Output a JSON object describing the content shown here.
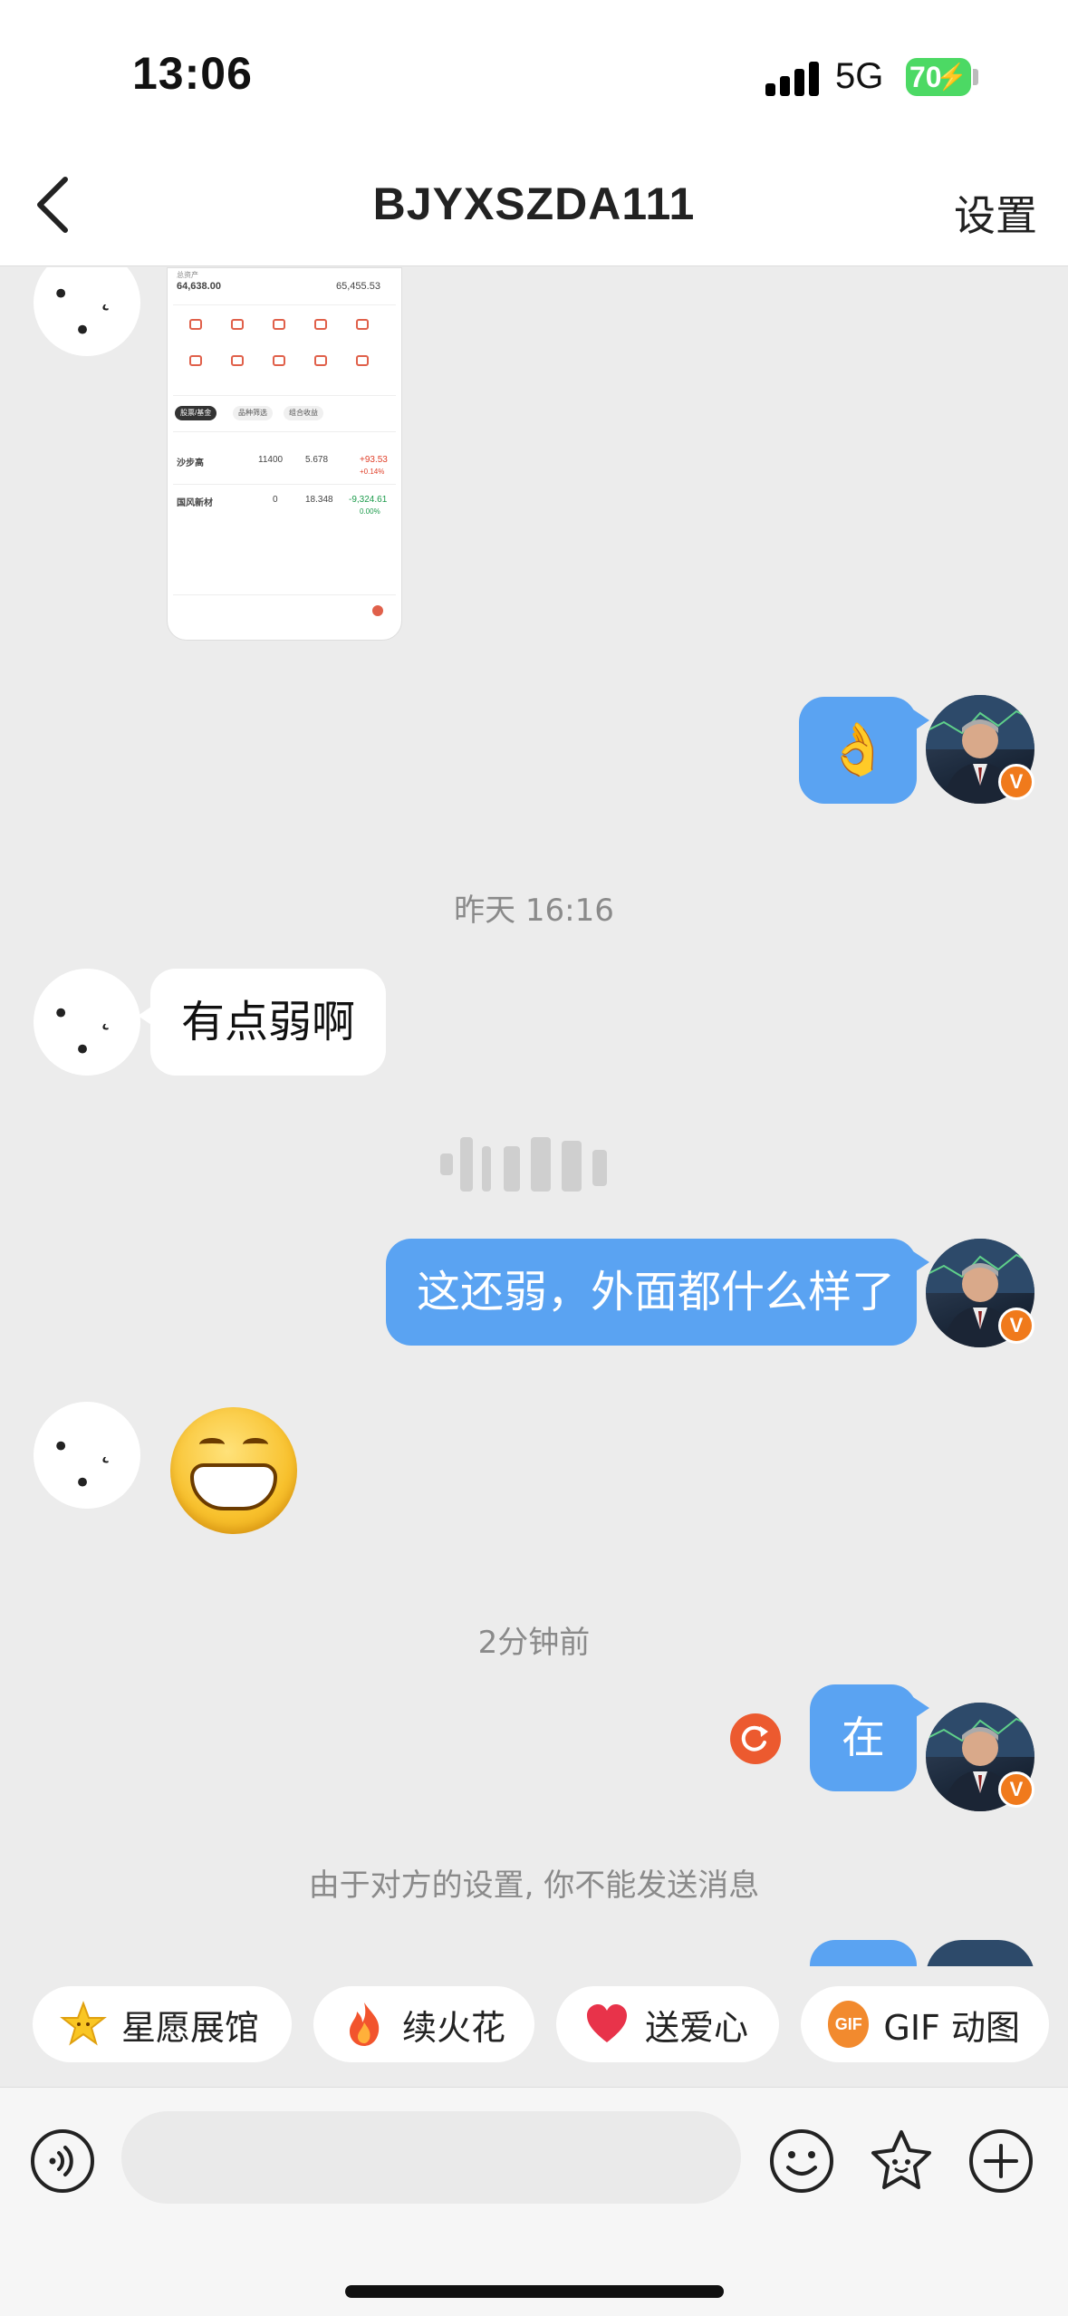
{
  "status_bar": {
    "time": "13:06",
    "network": "5G",
    "battery": "70"
  },
  "nav": {
    "title": "BJYXSZDA111",
    "settings_label": "设置"
  },
  "thumbnail": {
    "total_left": "64,638.00",
    "total_right": "65,455.53",
    "tab_1": "股票/基金",
    "tab_2": "品种筛选",
    "tab_3": "组合收益",
    "row_1_name": "沙步高",
    "row_1_qty": "11400",
    "row_1_price": "5.678",
    "row_1_pl": "+93.53",
    "row_1_pct": "+0.14%",
    "row_2_name": "国风新材",
    "row_2_qty": "0",
    "row_2_price": "18.348",
    "row_2_pl": "-9,324.61",
    "row_2_pct": "0.00%"
  },
  "messages": [
    {
      "side": "out",
      "text": "👌"
    },
    {
      "timestamp": "昨天 16:16"
    },
    {
      "side": "in",
      "text": "有点弱啊"
    },
    {
      "side": "out",
      "text": "这还弱，外面都什么样了"
    },
    {
      "side": "in",
      "text": "😁"
    },
    {
      "timestamp": "2分钟前"
    },
    {
      "side": "out",
      "text": "在",
      "failed": true
    },
    {
      "system": "由于对方的设置, 你不能发送消息"
    }
  ],
  "avatar_blank_face": "• ˛ •",
  "quick_actions": [
    {
      "label": "星愿展馆",
      "icon": "star-face-icon"
    },
    {
      "label": "续火花",
      "icon": "fire-icon"
    },
    {
      "label": "送爱心",
      "icon": "heart-icon"
    },
    {
      "label": "GIF 动图",
      "icon": "gif-icon",
      "badge": "GIF"
    }
  ],
  "input": {
    "placeholder": ""
  },
  "colors": {
    "bubble_out": "#5aa3f2",
    "bubble_in": "#ffffff",
    "accent_orange": "#f07a1c",
    "retry_red": "#ec5a2f",
    "battery_green": "#4cd964"
  }
}
